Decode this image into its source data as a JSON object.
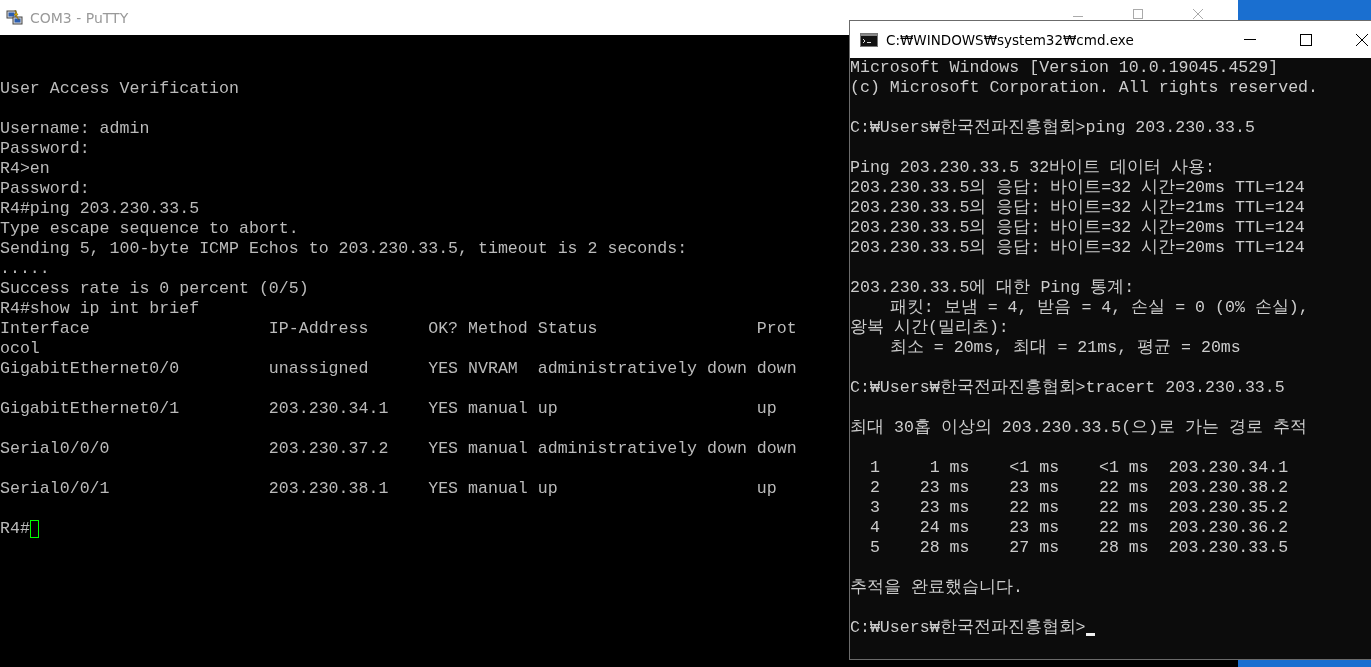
{
  "putty": {
    "title": "COM3 - PuTTY",
    "blocks": [
      [
        "User Access Verification"
      ],
      [
        "Username: admin",
        "Password:",
        "R4>en",
        "Password:",
        "R4#ping 203.230.33.5",
        "Type escape sequence to abort.",
        "Sending 5, 100-byte ICMP Echos to 203.230.33.5, timeout is 2 seconds:",
        ".....",
        "Success rate is 0 percent (0/5)",
        "R4#show ip int brief",
        "Interface                  IP-Address      OK? Method Status                Prot",
        "ocol",
        "GigabitEthernet0/0         unassigned      YES NVRAM  administratively down down"
      ],
      [
        "GigabitEthernet0/1         203.230.34.1    YES manual up                    up"
      ],
      [
        "Serial0/0/0                203.230.37.2    YES manual administratively down down"
      ],
      [
        "Serial0/0/1                203.230.38.1    YES manual up                    up"
      ]
    ],
    "prompt": "R4#"
  },
  "cmd": {
    "title": "C:₩WINDOWS₩system32₩cmd.exe",
    "blocks": [
      [
        "Microsoft Windows [Version 10.0.19045.4529]",
        "(c) Microsoft Corporation. All rights reserved."
      ],
      [
        "C:₩Users₩한국전파진흥협회>ping 203.230.33.5"
      ],
      [
        "Ping 203.230.33.5 32바이트 데이터 사용:",
        "203.230.33.5의 응답: 바이트=32 시간=20ms TTL=124",
        "203.230.33.5의 응답: 바이트=32 시간=21ms TTL=124",
        "203.230.33.5의 응답: 바이트=32 시간=20ms TTL=124",
        "203.230.33.5의 응답: 바이트=32 시간=20ms TTL=124"
      ],
      [
        "203.230.33.5에 대한 Ping 통계:",
        "    패킷: 보냄 = 4, 받음 = 4, 손실 = 0 (0% 손실),",
        "왕복 시간(밀리초):",
        "    최소 = 20ms, 최대 = 21ms, 평균 = 20ms"
      ],
      [
        "C:₩Users₩한국전파진흥협회>tracert 203.230.33.5"
      ],
      [
        "최대 30홉 이상의 203.230.33.5(으)로 가는 경로 추적"
      ],
      [
        "  1     1 ms    <1 ms    <1 ms  203.230.34.1",
        "  2    23 ms    23 ms    22 ms  203.230.38.2",
        "  3    23 ms    22 ms    22 ms  203.230.35.2",
        "  4    24 ms    23 ms    22 ms  203.230.36.2",
        "  5    28 ms    27 ms    28 ms  203.230.33.5"
      ],
      [
        "추적을 완료했습니다."
      ]
    ],
    "prompt": "C:₩Users₩한국전파진흥협회>"
  }
}
